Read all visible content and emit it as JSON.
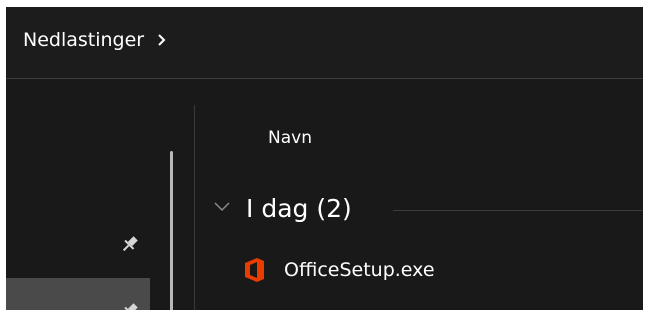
{
  "breadcrumb": {
    "current": "Nedlastinger"
  },
  "file_list": {
    "column_header": "Navn",
    "groups": [
      {
        "label": "I dag (2)",
        "items": [
          {
            "name": "OfficeSetup.exe",
            "icon": "office-icon"
          }
        ]
      }
    ]
  },
  "colors": {
    "window_background": "#191919",
    "addressbar_background": "#1c1c1c",
    "text": "#ffffff",
    "selected_nav_background": "#4a4a4a",
    "office_icon": "#eb3c00"
  }
}
